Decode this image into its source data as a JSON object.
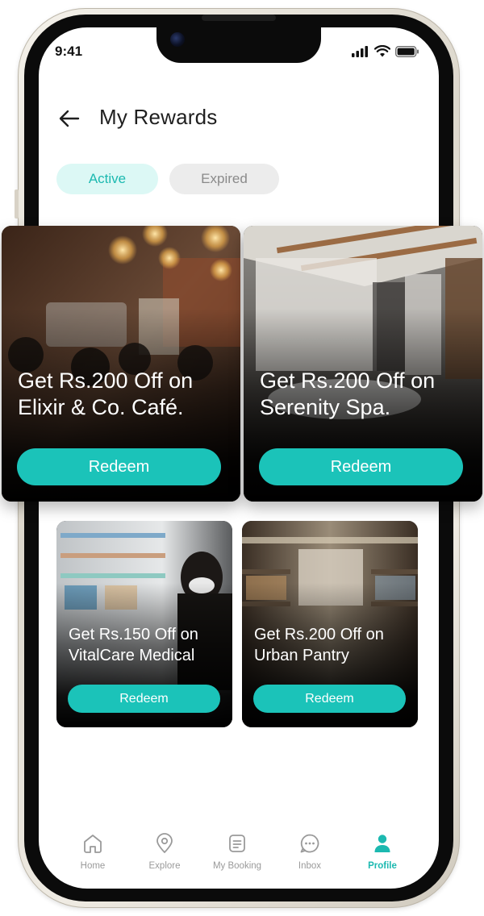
{
  "status_bar": {
    "time": "9:41"
  },
  "header": {
    "title": "My Rewards"
  },
  "tabs": [
    {
      "label": "Active",
      "selected": true
    },
    {
      "label": "Expired",
      "selected": false
    }
  ],
  "rewards": [
    {
      "title": "Get Rs.200 Off on\nElixir & Co. Café.",
      "button": "Redeem",
      "image": "cafe-photo"
    },
    {
      "title": "Get Rs.200 Off on\nSerenity Spa.",
      "button": "Redeem",
      "image": "spa-photo"
    },
    {
      "title": "Get Rs.150 Off on\nVitalCare Medical",
      "button": "Redeem",
      "image": "pharmacy-photo"
    },
    {
      "title": "Get Rs.200 Off on\nUrban Pantry",
      "button": "Redeem",
      "image": "grocery-photo"
    }
  ],
  "nav": [
    {
      "label": "Home",
      "icon": "home-icon",
      "active": false
    },
    {
      "label": "Explore",
      "icon": "map-pin-icon",
      "active": false
    },
    {
      "label": "My Booking",
      "icon": "booking-icon",
      "active": false
    },
    {
      "label": "Inbox",
      "icon": "chat-icon",
      "active": false
    },
    {
      "label": "Profile",
      "icon": "profile-icon",
      "active": true
    }
  ],
  "colors": {
    "accent": "#1bc3b9",
    "accent_text": "#1cb9b0",
    "active_tab_bg": "#dcf8f5",
    "inactive_tab_bg": "#ececec",
    "nav_inactive": "#9a9a9a"
  }
}
